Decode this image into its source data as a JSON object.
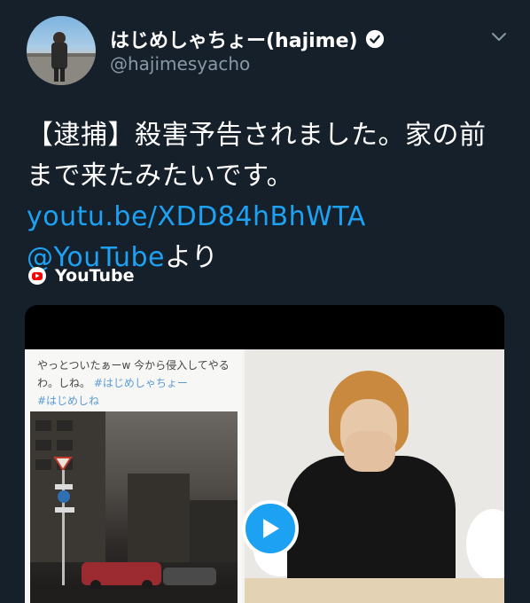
{
  "tweet": {
    "display_name": "はじめしゃちょー(hajime)",
    "handle": "@hajimesyacho",
    "text_plain_1": "【逮捕】殺害予告されました。家の前まで来たみたいです。",
    "link_url": "youtu.be/XDD84hBhWTA",
    "mention": "@YouTube",
    "text_plain_2": "より"
  },
  "icons": {
    "verified": "verified-badge-icon",
    "menu": "chevron-down-icon",
    "source": "youtube-logo-icon",
    "play": "play-icon"
  },
  "card": {
    "source_label": "YouTube",
    "embedded_tweet_text": "やっとついたぁーw 今から侵入してやるわ。しね。",
    "embedded_hashtag_1": "#はじめしゃちょー",
    "embedded_hashtag_2": "#はじめしね"
  },
  "colors": {
    "background": "#15202b",
    "link": "#1da1f2",
    "secondary_text": "#8899a6",
    "youtube_red": "#ff0000"
  }
}
